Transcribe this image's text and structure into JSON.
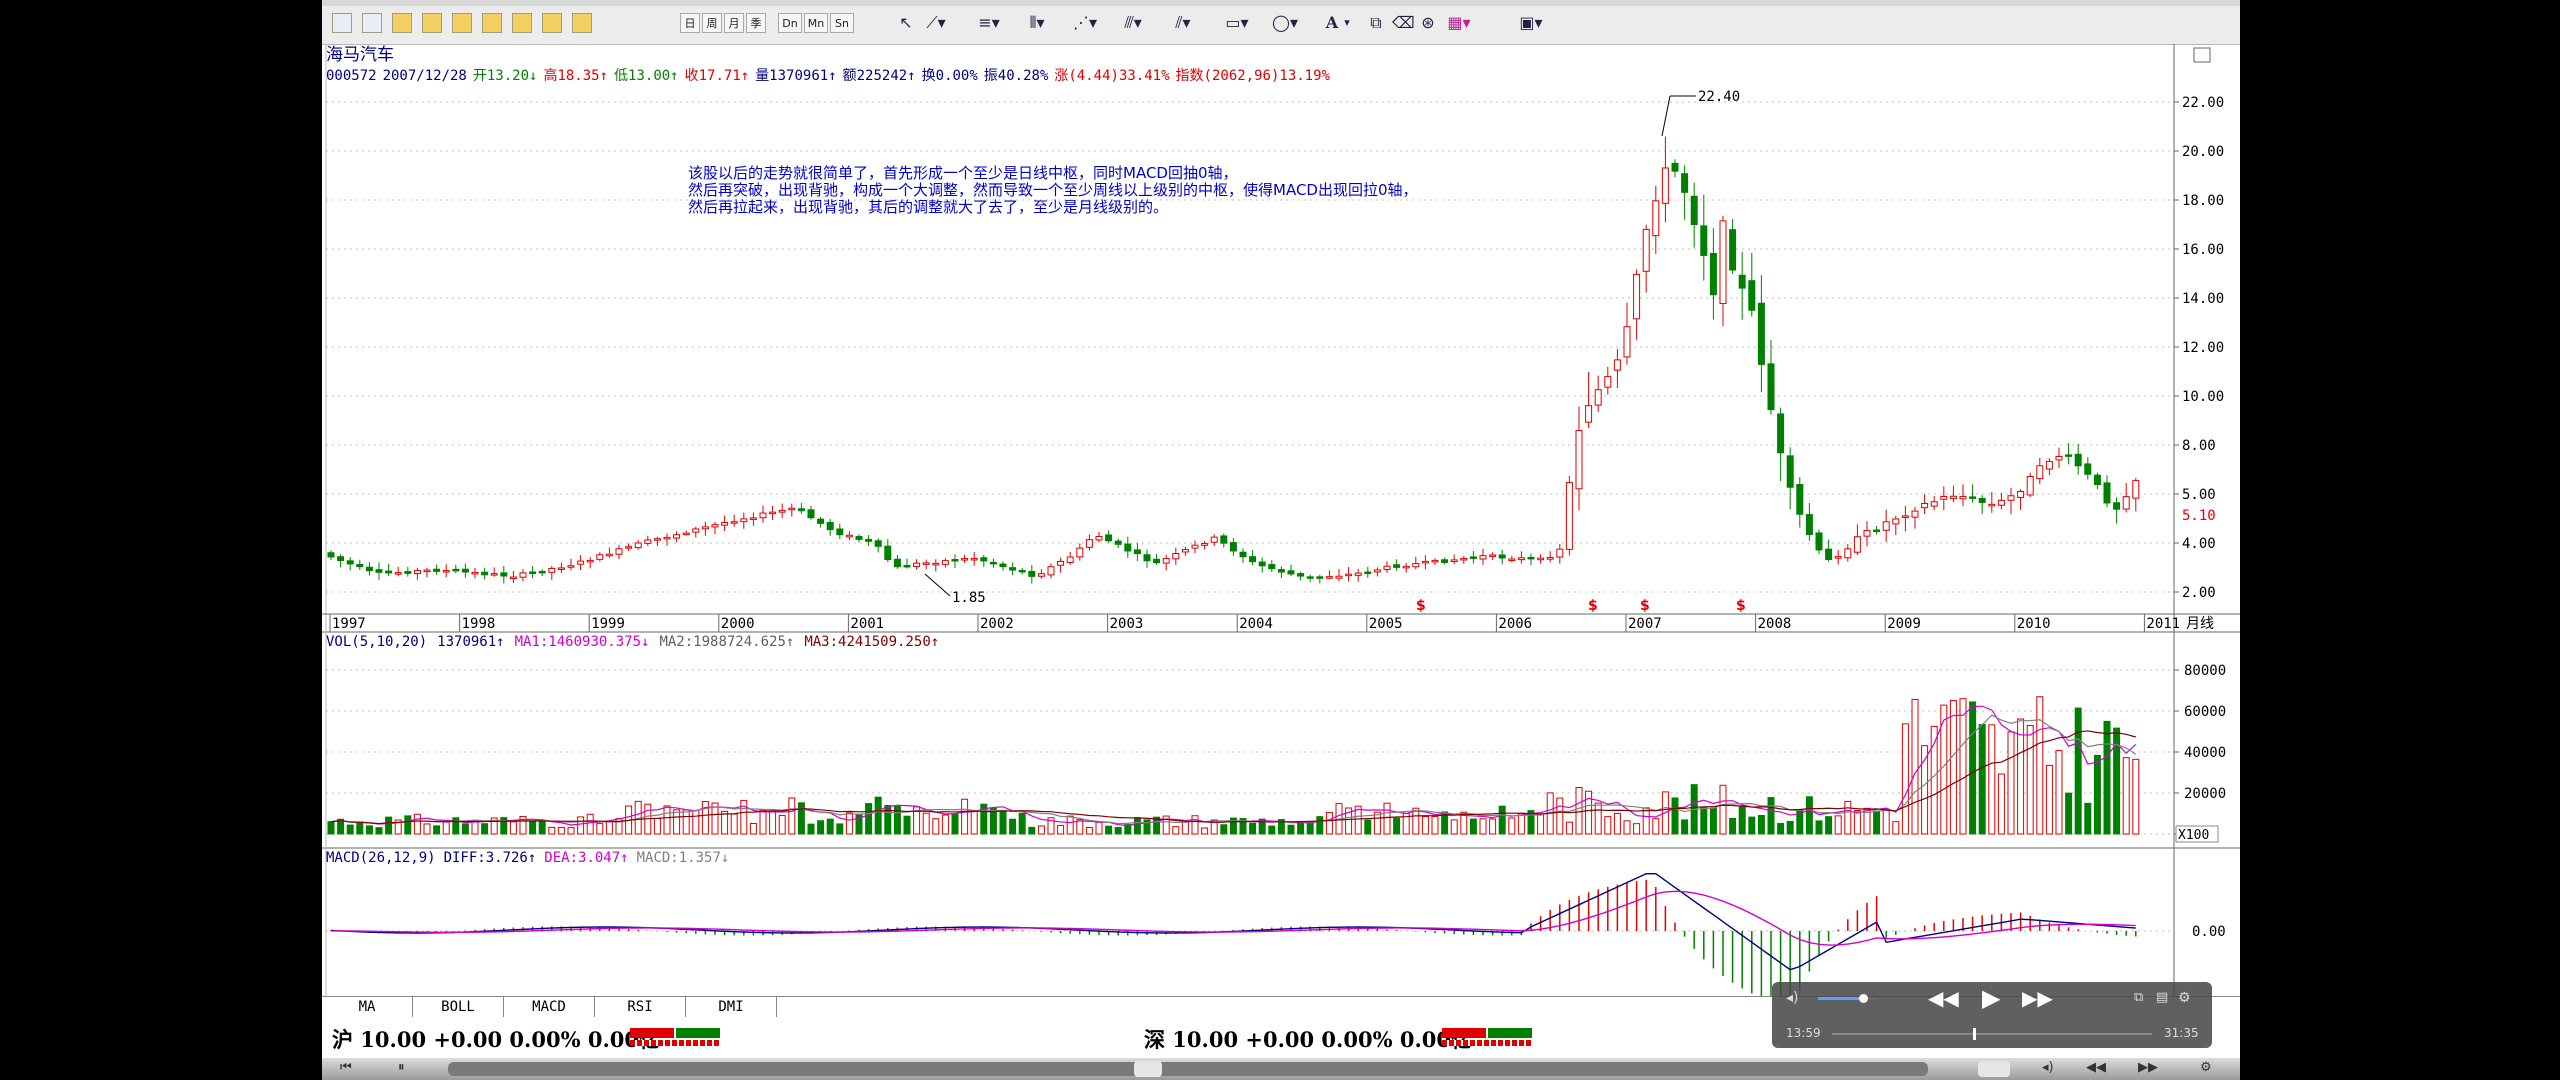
{
  "stock": {
    "name": "海马汽车",
    "quote": [
      {
        "text": "000572",
        "color": "#000080"
      },
      {
        "text": "2007/12/28",
        "color": "#000080"
      },
      {
        "text": "开13.20↓",
        "color": "#008000"
      },
      {
        "text": "高18.35↑",
        "color": "#e00000"
      },
      {
        "text": "低13.00↑",
        "color": "#008000"
      },
      {
        "text": "收17.71↑",
        "color": "#e00000"
      },
      {
        "text": "量1370961↑",
        "color": "#000080"
      },
      {
        "text": "额225242↑",
        "color": "#000080"
      },
      {
        "text": "换0.00%",
        "color": "#000080"
      },
      {
        "text": "振40.28%",
        "color": "#000080"
      },
      {
        "text": "涨(4.44)33.41%",
        "color": "#e00000"
      },
      {
        "text": "指数(2062,96)13.19%",
        "color": "#e00000"
      }
    ]
  },
  "annotation": [
    "该股以后的走势就很简单了，首先形成一个至少是日线中枢，同时MACD回抽0轴，",
    "然后再突破，出现背驰，构成一个大调整，然而导致一个至少周线以上级别的中枢，使得MACD出现回拉0轴，",
    "然后再拉起来，出现背驰，其后的调整就大了去了，至少是月线级别的。"
  ],
  "price_panel": {
    "y_ticks": [
      "22.00",
      "20.00",
      "18.00",
      "16.00",
      "14.00",
      "12.00",
      "10.00",
      "8.00",
      "5.00",
      "4.00",
      "2.00"
    ],
    "current_price_label": "5.10",
    "high_label": "22.40",
    "low_label": "1.85",
    "period_label": "月线",
    "years": [
      "1997",
      "1998",
      "1999",
      "2000",
      "2001",
      "2002",
      "2003",
      "2004",
      "2005",
      "2006",
      "2007",
      "2008",
      "2009",
      "2010",
      "2011"
    ],
    "dividend_marker": "$"
  },
  "vol_panel": {
    "header": [
      {
        "text": "VOL(5,10,20)",
        "color": "#000080"
      },
      {
        "text": "1370961↑",
        "color": "#000080"
      },
      {
        "text": "MA1:1460930.375↓",
        "color": "#d000d0"
      },
      {
        "text": "MA2:1988724.625↑",
        "color": "#606060"
      },
      {
        "text": "MA3:4241509.250↑",
        "color": "#800000"
      }
    ],
    "y_ticks": [
      "80000",
      "60000",
      "40000",
      "20000",
      "0"
    ],
    "unit": "X100"
  },
  "macd_panel": {
    "header": [
      {
        "text": "MACD(26,12,9)",
        "color": "#000080"
      },
      {
        "text": "DIFF:3.726↑",
        "color": "#000080"
      },
      {
        "text": "DEA:3.047↑",
        "color": "#d000d0"
      },
      {
        "text": "MACD:1.357↓",
        "color": "#808080"
      }
    ],
    "zero_label": "0.00"
  },
  "tabs": [
    "MA",
    "BOLL",
    "MACD",
    "RSI",
    "DMI"
  ],
  "status": {
    "sh": "沪 10.00 +0.00 0.00% 0.00亿",
    "sz": "深 10.00 +0.00 0.00% 0.00亿"
  },
  "toolbar": {
    "period_buttons": [
      "日",
      "周",
      "月",
      "季",
      "Dn",
      "Mn",
      "Sn"
    ],
    "text_tool": "A"
  },
  "player": {
    "time_current": "13:59",
    "time_total": "31:35",
    "progress": 0.44,
    "volume": 0.75
  }
}
